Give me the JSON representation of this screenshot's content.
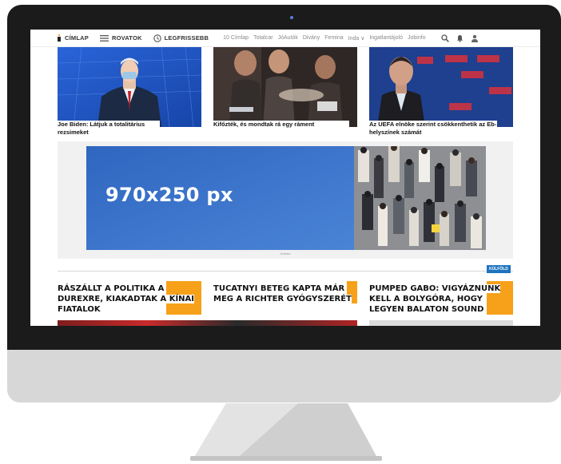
{
  "nav": {
    "main": [
      {
        "label": "CÍMLAP",
        "icon": "cimlap-icon"
      },
      {
        "label": "ROVATOK",
        "icon": "menu-icon"
      },
      {
        "label": "LEGFRISSEBB",
        "icon": "clock-icon"
      }
    ],
    "links": [
      "10 Címlap",
      "Totalcar",
      "JóAutók",
      "Divány",
      "Femina",
      "Inda ∨",
      "Ingatlantájoló",
      "Jobinfo"
    ],
    "icons": [
      "search-icon",
      "bell-icon",
      "user-icon"
    ]
  },
  "top_articles": [
    {
      "caption": "Joe Biden: Látjuk a totalitárius rezsimeket"
    },
    {
      "caption": "Kifőzték, és mondtak rá egy ráment"
    },
    {
      "caption": "Az UEFA elnöke szerint csökkenthetik az Eb-helyszínek számát"
    }
  ],
  "ad": {
    "text": "970x250 px",
    "label": "Hirdetés"
  },
  "section_badge": "KÜLFÖLD",
  "headlines": [
    {
      "text": "Rászállt a politika a Durexre, kiakadtak a kínai fiatalok"
    },
    {
      "text": "Tucatnyi beteg kapta már meg a Richter gyógyszerét"
    },
    {
      "text": "Pumped Gabo: Vigyáznunk kell a bolygóra, hogy legyen Balaton Sound"
    }
  ],
  "colors": {
    "accent": "#f7a11a",
    "badge": "#1e73be",
    "ad_blue": "#3a72c7"
  }
}
